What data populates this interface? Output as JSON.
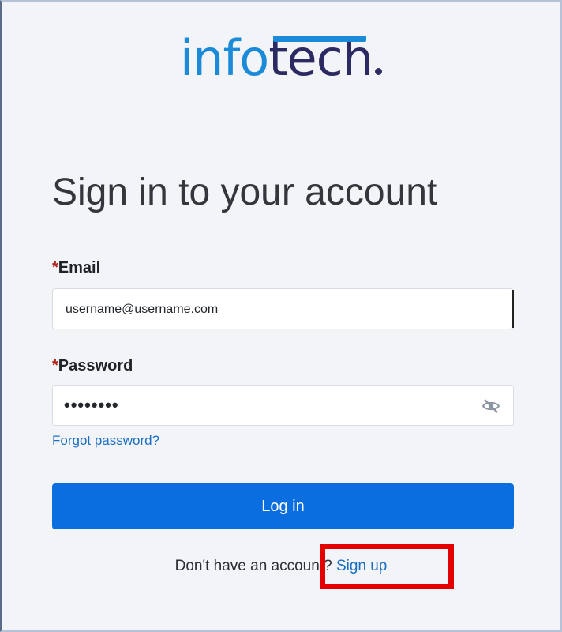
{
  "brand": {
    "logo_part1": "info",
    "logo_part2": "tech",
    "primary_color": "#0a6de0",
    "logo_blue": "#1a8ad9",
    "logo_navy": "#2c2a63"
  },
  "form": {
    "title": "Sign in to your account",
    "email": {
      "required_mark": "*",
      "label": "Email",
      "value": "username@username.com"
    },
    "password": {
      "required_mark": "*",
      "label": "Password",
      "masked_value": "••••••••",
      "toggle_icon": "eye-slash-icon"
    },
    "forgot_password": "Forgot password?",
    "login_button": "Log in",
    "signup_prompt": "Don't have an account?",
    "signup_link": "Sign up"
  },
  "annotation": {
    "highlight_color": "#e50000",
    "highlight_target": "signup-link"
  }
}
